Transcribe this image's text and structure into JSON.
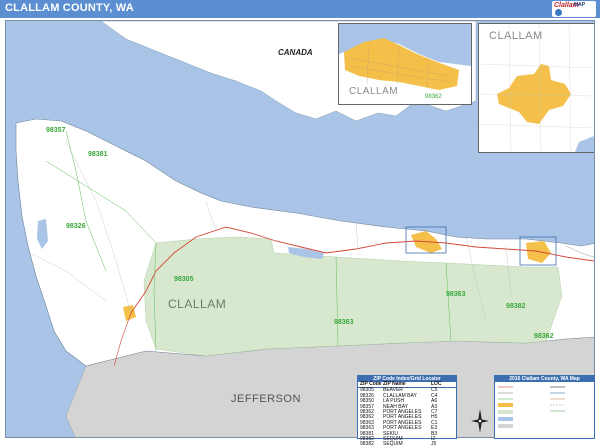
{
  "header": {
    "title": "CLALLAM COUNTY, WA",
    "brand_line1": "Clallam",
    "brand_line2": "MAP"
  },
  "map": {
    "country_label": "CANADA",
    "county_label": "CLALLAM",
    "neighbor_county_label": "JEFFERSON",
    "zip_labels": [
      "98357",
      "98381",
      "98326",
      "98305",
      "98363",
      "98363",
      "98362",
      "98382"
    ],
    "colors": {
      "water": "#a9c4e6",
      "land": "#ffffff",
      "canada": "#ffffff",
      "national_park": "#d8e8cf",
      "jefferson": "#d4d4d4",
      "urban": "#f4c04a",
      "road": "#d24a3a",
      "zip_line": "#5bbf5b"
    }
  },
  "insets": {
    "port_angeles": {
      "label": "CLALLAM",
      "zip": "98362"
    },
    "sequim": {
      "label": "CLALLAM"
    }
  },
  "zip_index": {
    "title": "ZIP Code Index/Grid Locator",
    "columns": [
      "ZIP Code",
      "ZIP Name",
      "LOC"
    ],
    "rows": [
      [
        "98305",
        "BEAVER",
        "C5"
      ],
      [
        "98326",
        "CLALLAM BAY",
        "C4"
      ],
      [
        "98350",
        "LA PUSH",
        "A6"
      ],
      [
        "98357",
        "NEAH BAY",
        "A3"
      ],
      [
        "98362",
        "PORT ANGELES",
        "C7"
      ],
      [
        "98362",
        "PORT ANGELES",
        "H5"
      ],
      [
        "98363",
        "PORT ANGELES",
        "C1"
      ],
      [
        "98363",
        "PORT ANGELES",
        "E3"
      ],
      [
        "98381",
        "SEKIU",
        "B3"
      ],
      [
        "98382",
        "SEQUIM",
        "I2"
      ],
      [
        "98382",
        "SEQUIM",
        "J5"
      ]
    ]
  },
  "legend": {
    "title": "2016 Clallam County, WA Map"
  }
}
